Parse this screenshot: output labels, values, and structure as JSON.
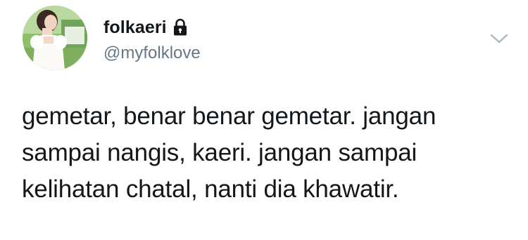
{
  "tweet": {
    "author": {
      "display_name": "folkaeri",
      "handle": "@myfolklove",
      "protected_icon": "lock-icon",
      "avatar": "profile-photo"
    },
    "menu_icon": "chevron-down-icon",
    "text_lines": [
      "gemetar, benar benar gemetar. jangan",
      "sampai nangis, kaeri. jangan sampai",
      "kelihatan chatal, nanti dia khawatir."
    ]
  },
  "colors": {
    "text": "#14171a",
    "secondary_text": "#657786",
    "chevron": "#aab8c2",
    "background": "#ffffff"
  }
}
